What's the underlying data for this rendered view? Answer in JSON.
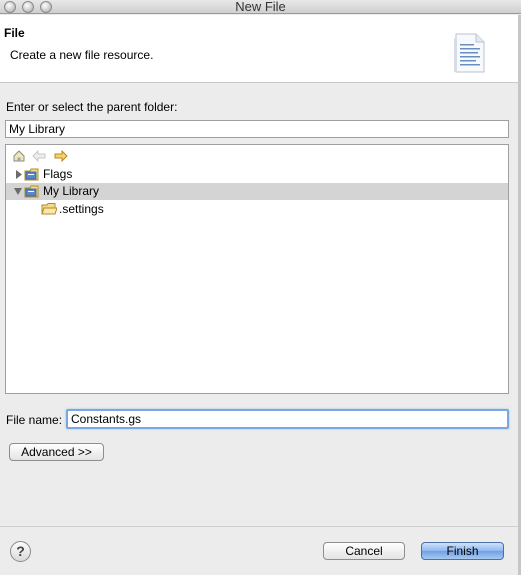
{
  "window": {
    "title": "New File"
  },
  "banner": {
    "title": "File",
    "description": "Create a new file resource.",
    "icon": "document-icon"
  },
  "parent_folder": {
    "label": "Enter or select the parent folder:",
    "value": "My Library"
  },
  "tree": {
    "toolbar": [
      "home-icon",
      "back-icon",
      "forward-icon"
    ],
    "items": [
      {
        "label": "Flags",
        "icon": "project-icon",
        "expanded": false,
        "selected": false
      },
      {
        "label": "My Library",
        "icon": "project-icon",
        "expanded": true,
        "selected": true
      },
      {
        "label": ".settings",
        "icon": "folder-icon",
        "expanded": false,
        "selected": false
      }
    ]
  },
  "file_name": {
    "label": "File name:",
    "value": "Constants.gs"
  },
  "buttons": {
    "advanced": "Advanced >>",
    "cancel": "Cancel",
    "finish": "Finish",
    "help": "?"
  },
  "colors": {
    "accent": "#6fa0e4",
    "focus_ring": "#7aa7e0",
    "selection": "#d4d4d4"
  }
}
